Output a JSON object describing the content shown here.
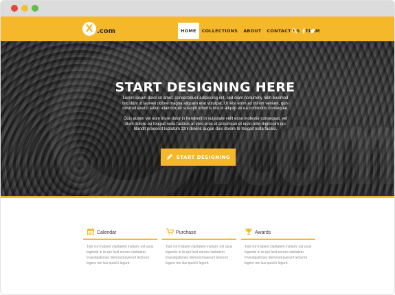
{
  "colors": {
    "accent": "#f5b82b",
    "nav_text": "#3a2a05",
    "hero_text": "#ffffff"
  },
  "window": {
    "buttons": [
      "close",
      "minimize",
      "maximize"
    ]
  },
  "logo": {
    "mark": "X",
    "text": ".com"
  },
  "nav": {
    "items": [
      {
        "label": "HOME",
        "active": true
      },
      {
        "label": "COLLECTIONS",
        "active": false
      },
      {
        "label": "ABOUT",
        "active": false
      },
      {
        "label": "CONTACT US",
        "active": false
      },
      {
        "label": "TEAM",
        "active": false
      }
    ],
    "icons": [
      "search-icon",
      "facebook-icon",
      "twitter-icon"
    ]
  },
  "hero": {
    "title": "START DESIGNING HERE",
    "paragraph1": "Lorem ipsum dolor sit amet, consectetuer adipiscing elit, sed diam nonummy nibh euismod tincidunt ut laoreet dolore magna aliquam erat volutpat. Ut wisi enim ad minim veniam, quis nostrud exerci tation ullamcorper suscipit lobortis nisl ut aliquip ex ea commodo consequat.",
    "paragraph2": "Duis autem vel eum iriure dolor in hendrerit in vulputate velit esse molestie consequat, vel illum dolore eu feugiat nulla facilisis at vero eros et accumsan et iusto odio dignissim qui blandit praesent luptatum zzril delenit augue duis dolore te feugait nulla facilisi.",
    "cta_label": "START DESIGNING",
    "cta_icon": "pencil-icon",
    "watermark": ".com"
  },
  "features": [
    {
      "title": "Calendar",
      "icon": "calendar-icon",
      "text": "Typi non habent claritatem insitam; est usus legentis in iis qui facit eorum claritatem. Investigationes demonstraverunt lectores legere me lius quod ii legunt."
    },
    {
      "title": "Purchase",
      "icon": "cart-icon",
      "text": "Typi non habent claritatem insitam; est usus legentis in iis qui facit eorum claritatem. Investigationes demonstraverunt lectores legere me lius quod ii legunt."
    },
    {
      "title": "Awards",
      "icon": "trophy-icon",
      "text": "Typi non habent claritatem insitam; est usus legentis in iis qui facit eorum claritatem. Investigationes demonstraverunt lectores legere me lius quod ii legunt."
    }
  ]
}
